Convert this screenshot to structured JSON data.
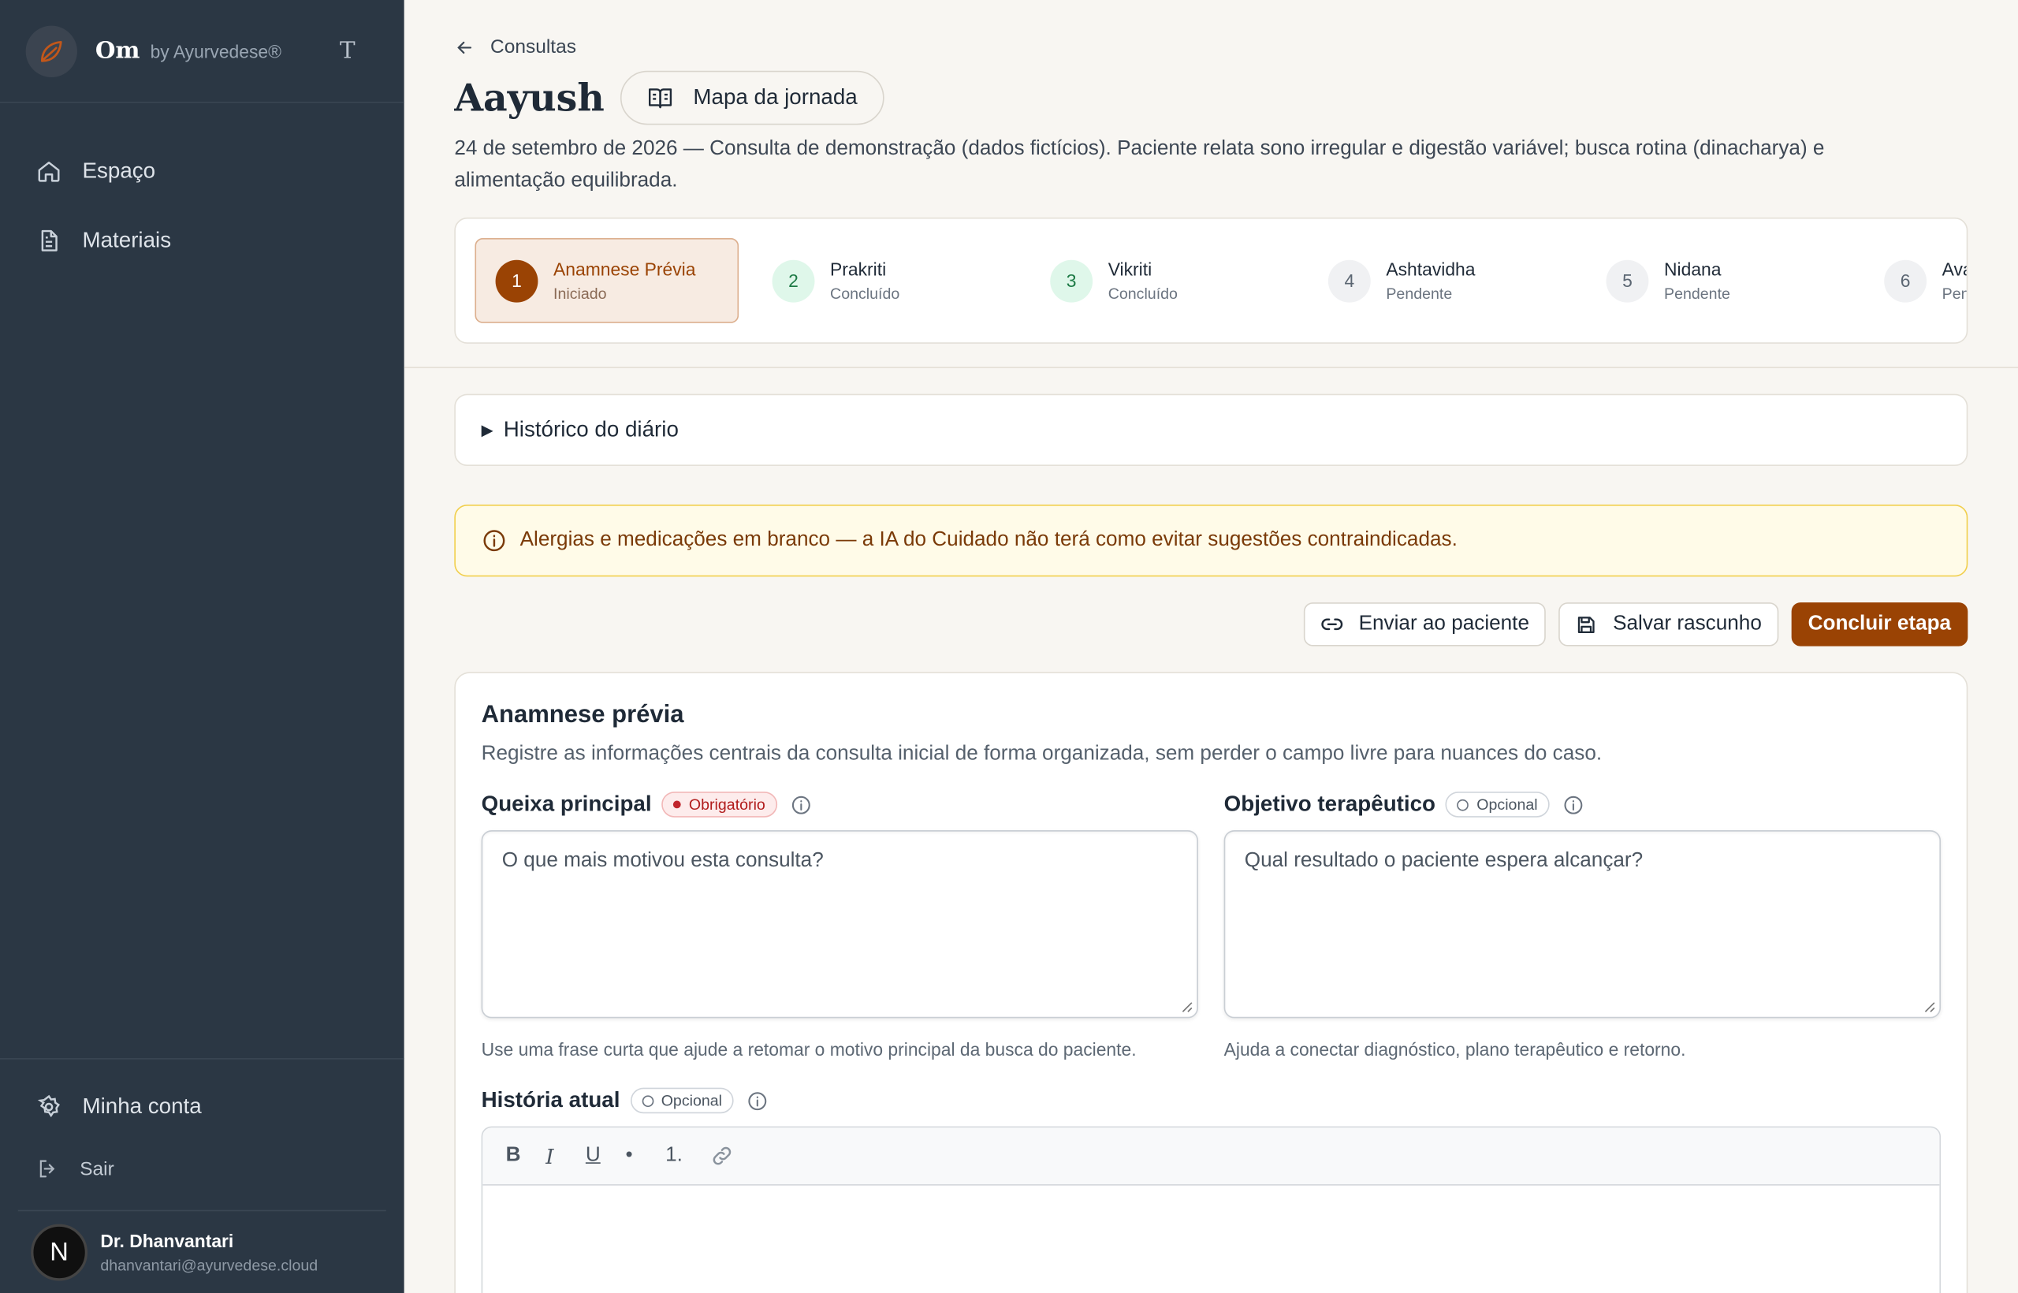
{
  "brand": {
    "name": "Om",
    "by": "by Ayurvedese®",
    "toggle": "T"
  },
  "nav": {
    "items": [
      {
        "label": "Espaço"
      },
      {
        "label": "Materiais"
      }
    ]
  },
  "sidebar_bottom": {
    "account": "Minha conta",
    "logout": "Sair"
  },
  "user": {
    "initial": "N",
    "name": "Dr. Dhanvantari",
    "email": "dhanvantari@ayurvedese.cloud"
  },
  "header": {
    "back_label": "Consultas",
    "patient_name": "Aayush",
    "journey_button": "Mapa da jornada",
    "description": "24 de setembro de 2026 — Consulta de demonstração (dados fictícios). Paciente relata sono irregular e digestão variável; busca rotina (dinacharya) e alimentação equilibrada."
  },
  "steps": [
    {
      "num": "1",
      "label": "Anamnese Prévia",
      "status": "Iniciado",
      "state": "active"
    },
    {
      "num": "2",
      "label": "Prakriti",
      "status": "Concluído",
      "state": "done"
    },
    {
      "num": "3",
      "label": "Vikriti",
      "status": "Concluído",
      "state": "done"
    },
    {
      "num": "4",
      "label": "Ashtavidha",
      "status": "Pendente",
      "state": "pending"
    },
    {
      "num": "5",
      "label": "Nidana",
      "status": "Pendente",
      "state": "pending"
    },
    {
      "num": "6",
      "label": "Ava",
      "status": "Pend",
      "state": "pending"
    }
  ],
  "diary": {
    "label": "Histórico do diário"
  },
  "alert": {
    "text": "Alergias e medicações em branco — a IA do Cuidado não terá como evitar sugestões contraindicadas."
  },
  "actions": {
    "send": "Enviar ao paciente",
    "save": "Salvar rascunho",
    "finish": "Concluir etapa"
  },
  "form": {
    "title": "Anamnese prévia",
    "subtitle": "Registre as informações centrais da consulta inicial de forma organizada, sem perder o campo livre para nuances do caso.",
    "complaint": {
      "label": "Queixa principal",
      "badge": "Obrigatório",
      "placeholder": "O que mais motivou esta consulta?",
      "hint": "Use uma frase curta que ajude a retomar o motivo principal da busca do paciente."
    },
    "goal": {
      "label": "Objetivo terapêutico",
      "badge": "Opcional",
      "placeholder": "Qual resultado o paciente espera alcançar?",
      "hint": "Ajuda a conectar diagnóstico, plano terapêutico e retorno."
    },
    "history": {
      "label": "História atual",
      "badge": "Opcional",
      "toolbar": {
        "bold": "B",
        "italic": "I",
        "underline": "U",
        "bullet": "•",
        "ordered": "1."
      }
    }
  },
  "colors": {
    "sidebar": "#2b3744",
    "accent": "#9a4304",
    "background": "#f8f6f2",
    "alert_bg": "#fffbe8"
  }
}
